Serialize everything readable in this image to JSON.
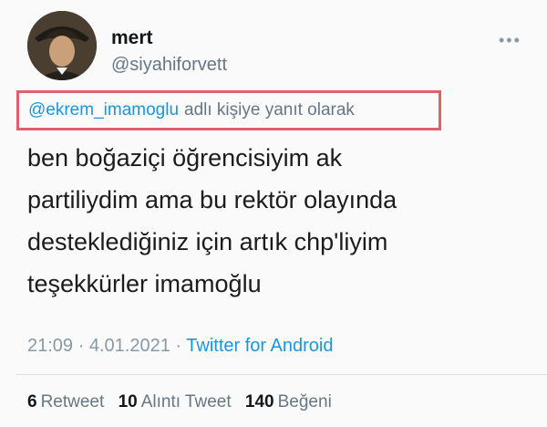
{
  "user": {
    "name": "mert",
    "handle": "@siyahiforvett"
  },
  "reply_context": {
    "mention": "@ekrem_imamoglu",
    "text": "adlı kişiye yanıt olarak",
    "highlight_color": "#e0606a"
  },
  "tweet": {
    "lines": [
      "ben boğaziçi öğrencisiyim ak",
      "partiliydim ama bu rektör olayında",
      "desteklediğiniz için artık chp'liyim",
      "teşekkürler imamoğlu"
    ]
  },
  "meta": {
    "time": "21:09",
    "separator1": "·",
    "date": "4.01.2021",
    "separator2": "·",
    "source": "Twitter for Android"
  },
  "stats": {
    "retweets_count": "6",
    "retweets_label": "Retweet",
    "quotes_count": "10",
    "quotes_label": "Alıntı Tweet",
    "likes_count": "140",
    "likes_label": "Beğeni"
  },
  "icons": {
    "more": "more-dots-icon",
    "avatar": "profile-photo"
  },
  "colors": {
    "link": "#1b95e0",
    "secondary_text": "#657786"
  }
}
